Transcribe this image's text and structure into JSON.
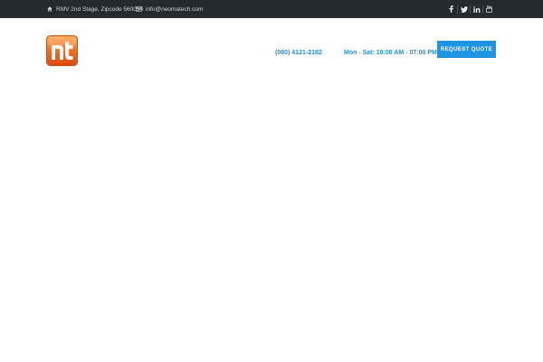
{
  "topbar": {
    "address": "RMV 2nd Stage, Zipcode 560094",
    "email": "info@neomatech.com",
    "address_icon": "home-icon",
    "email_icon": "envelope-icon",
    "social": [
      {
        "icon": "facebook-icon",
        "glyph": "f"
      },
      {
        "icon": "twitter-icon",
        "glyph": "t"
      },
      {
        "icon": "linkedin-icon",
        "glyph": "in"
      },
      {
        "icon": "youtube-icon",
        "glyph": "yt"
      }
    ]
  },
  "header": {
    "logo": "nt",
    "phone": "(080) 4121-2182",
    "hours": "Mon - Sat: 10:00 AM - 07:00 PM",
    "quote_button": "REQUEST QUOTE"
  },
  "colors": {
    "topbar_bg": "#252a2f",
    "accent": "#1e95e2",
    "logo_orange": "#f26a21"
  }
}
